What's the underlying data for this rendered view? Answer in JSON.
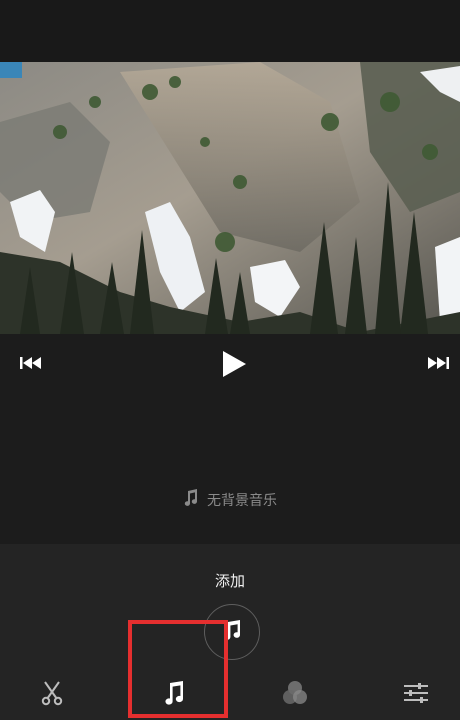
{
  "player": {
    "controls": {
      "previous_icon": "skip-previous-icon",
      "play_icon": "play-icon",
      "next_icon": "skip-next-icon"
    }
  },
  "music": {
    "status_text": "无背景音乐",
    "status_icon": "music-note-icon"
  },
  "panel": {
    "add_label": "添加",
    "add_icon": "add-music-icon"
  },
  "tabs": [
    {
      "id": "trim",
      "icon": "scissors-icon"
    },
    {
      "id": "music",
      "icon": "music-note-icon",
      "selected": true
    },
    {
      "id": "filter",
      "icon": "filter-circles-icon"
    },
    {
      "id": "adjust",
      "icon": "sliders-icon"
    }
  ],
  "colors": {
    "background": "#1c1c1c",
    "panel": "#242424",
    "highlight": "#e52f2f",
    "muted_text": "#8a8a8a"
  }
}
